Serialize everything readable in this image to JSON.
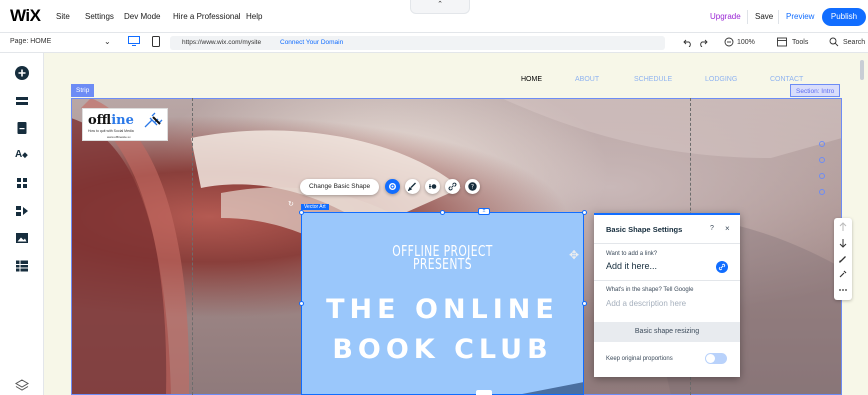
{
  "topbar": {
    "logo": "WiX",
    "menu": [
      "Site",
      "Settings",
      "Dev Mode",
      "Hire a Professional",
      "Help"
    ],
    "notch": "⌃",
    "upgrade": "Upgrade",
    "save": "Save",
    "preview": "Preview",
    "publish": "Publish"
  },
  "addressbar": {
    "page_select": "Page: HOME",
    "url": "https://www.wix.com/mysite",
    "connect_domain": "Connect Your Domain",
    "zoom": "100%",
    "tools": "Tools",
    "search": "Search"
  },
  "site_nav": {
    "items": [
      "HOME",
      "ABOUT",
      "SCHEDULE",
      "LODGING",
      "CONTACT"
    ],
    "active_color": "#222222",
    "inactive_color": "#8fb3f0"
  },
  "canvas": {
    "strip_label": "Strip",
    "section_label": "Section: Intro",
    "site_logo": {
      "word_prefix": "off",
      "word_suffix": "line",
      "tagline": "How to quit with Social Media",
      "url": "www.offlinesite.xx"
    },
    "shape_tag": "Vector Art",
    "shape_text": {
      "line1": "OFFLINE PROJECT",
      "line2": "PRESENTS",
      "line3": "THE ONLINE",
      "line4": "BOOK CLUB"
    }
  },
  "floating_toolbar": {
    "change_shape": "Change Basic Shape"
  },
  "panel": {
    "title": "Basic Shape Settings",
    "help": "?",
    "close": "×",
    "link_question": "Want to add a link?",
    "link_value": "Add it here...",
    "desc_question": "What's in the shape? Tell Google",
    "desc_placeholder": "Add a description here",
    "resize_label": "Basic shape resizing",
    "keep_label": "Keep original proportions"
  },
  "colors": {
    "accent": "#116dff",
    "upgrade": "#9a27d5",
    "shape_fill": "#9ac7fb"
  }
}
